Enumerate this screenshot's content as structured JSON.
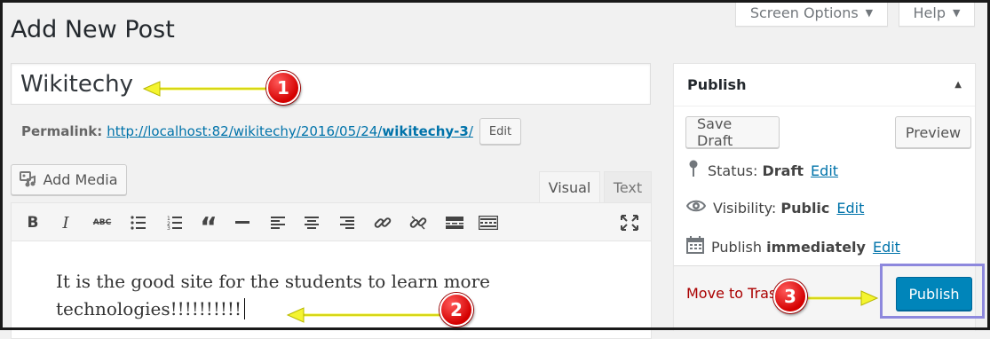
{
  "top_tabs": {
    "screen_options": "Screen Options",
    "help": "Help"
  },
  "page_title": "Add New Post",
  "title_input": {
    "value": "Wikitechy"
  },
  "permalink": {
    "label": "Permalink:",
    "url_base": "http://localhost:82/wikitechy/2016/05/24/",
    "slug": "wikitechy-3",
    "url_end": "/",
    "edit_label": "Edit"
  },
  "editor": {
    "add_media_label": "Add Media",
    "tabs": {
      "visual": "Visual",
      "text": "Text"
    },
    "toolbar_icons": [
      "bold-icon",
      "italic-icon",
      "strikethrough-icon",
      "bullet-list-icon",
      "numbered-list-icon",
      "blockquote-icon",
      "horizontal-rule-icon",
      "align-left-icon",
      "align-center-icon",
      "align-right-icon",
      "link-icon",
      "unlink-icon",
      "read-more-icon",
      "toolbar-toggle-icon",
      "fullscreen-icon"
    ],
    "content_line1": "It is the good site for the students to learn more",
    "content_line2": "technologies!!!!!!!!!!"
  },
  "publish_box": {
    "title": "Publish",
    "save_draft": "Save Draft",
    "preview": "Preview",
    "status_label": "Status:",
    "status_value": "Draft",
    "visibility_label": "Visibility:",
    "visibility_value": "Public",
    "publish_label": "Publish",
    "publish_value": "immediately",
    "edit_link": "Edit",
    "move_to_trash": "Move to Trash",
    "publish_button": "Publish"
  },
  "callouts": [
    "1",
    "2",
    "3"
  ],
  "colors": {
    "link": "#0073aa",
    "primary_button": "#0085ba",
    "trash": "#a00",
    "callout": "#d40000",
    "arrow": "#f4f430",
    "highlight": "#8d88dd"
  }
}
